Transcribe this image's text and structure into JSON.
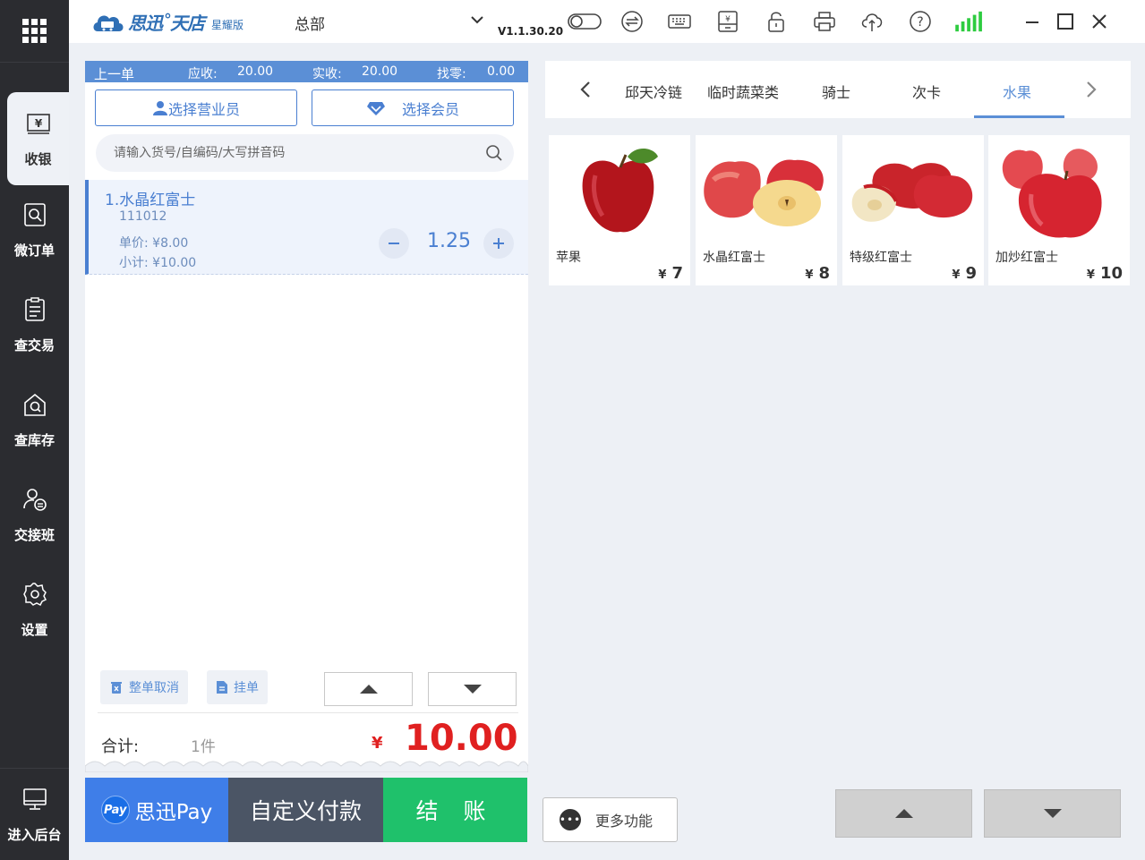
{
  "app": {
    "brand_name": "思迅˚天店",
    "brand_edition": "星耀版",
    "store": "总部",
    "version": "V1.1.30.20"
  },
  "sidebar": {
    "items": [
      {
        "label": "收银",
        "icon": "cash-register-icon",
        "active": true
      },
      {
        "label": "微订单",
        "icon": "order-search-icon"
      },
      {
        "label": "查交易",
        "icon": "transaction-icon"
      },
      {
        "label": "查库存",
        "icon": "inventory-icon"
      },
      {
        "label": "交接班",
        "icon": "shift-handover-icon"
      },
      {
        "label": "设置",
        "icon": "gear-icon"
      }
    ],
    "bottom_label": "进入后台"
  },
  "summary": {
    "prev": "上一单",
    "due_label": "应收:",
    "due": "20.00",
    "paid_label": "实收:",
    "paid": "20.00",
    "change_label": "找零:",
    "change": "0.00"
  },
  "buttons": {
    "select_clerk": "选择营业员",
    "select_member": "选择会员",
    "cancel_order": "整单取消",
    "hold_order": "挂单",
    "more": "更多功能"
  },
  "search": {
    "placeholder": "请输入货号/自编码/大写拼音码"
  },
  "cart": {
    "items": [
      {
        "name": "1.水晶红富士",
        "code": "111012",
        "unit_price": "单价: ¥8.00",
        "subtotal": "小计: ¥10.00",
        "qty": "1.25"
      }
    ]
  },
  "total": {
    "label": "合计:",
    "count": "1件",
    "symbol": "¥",
    "amount": "10.00"
  },
  "pay": {
    "badge": "Pay",
    "sixun_pay": "思迅Pay",
    "custom": "自定义付款",
    "checkout": "结 账"
  },
  "categories": {
    "items": [
      "邱天冷链",
      "临时蔬菜类",
      "骑士",
      "次卡",
      "水果"
    ],
    "active": "水果"
  },
  "products": [
    {
      "name": "苹果",
      "symbol": "¥",
      "price": "7"
    },
    {
      "name": "水晶红富士",
      "symbol": "¥",
      "price": "8"
    },
    {
      "name": "特级红富士",
      "symbol": "¥",
      "price": "9"
    },
    {
      "name": "加炒红富士",
      "symbol": "¥",
      "price": "10"
    }
  ],
  "colors": {
    "accent": "#4a7fd1",
    "total": "#e02020",
    "checkout": "#1fc16b",
    "sidebar": "#2b2c30"
  }
}
